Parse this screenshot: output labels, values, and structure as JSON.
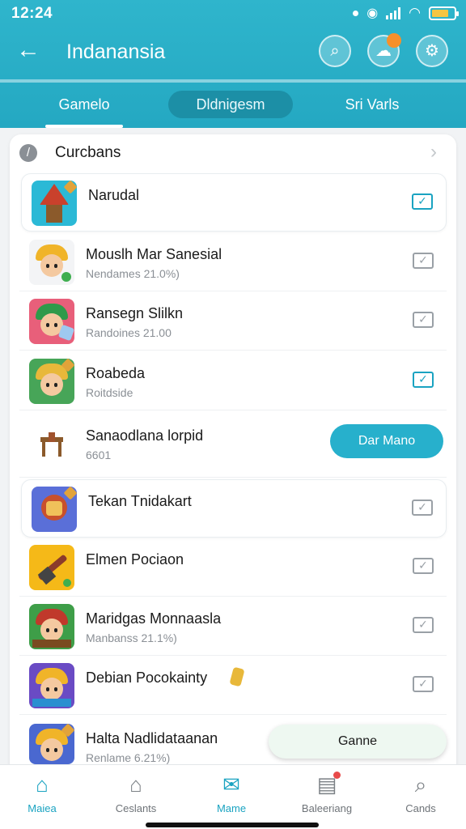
{
  "status_bar": {
    "time": "12:24"
  },
  "header": {
    "title": "Indanansia",
    "back_icon": "arrow-left-icon",
    "icons": [
      "search-icon",
      "avatar-chat-icon",
      "settings-icon"
    ],
    "accent": "#2fb5cc"
  },
  "tabs": [
    {
      "label": "Gamelo"
    },
    {
      "label": "Dldnigesm"
    },
    {
      "label": "Sri Varls"
    }
  ],
  "section": {
    "title": "Curcbans"
  },
  "rows": [
    {
      "title": "Narudal",
      "subtitle": "",
      "checked": true
    },
    {
      "title": "Mouslh Mar Sanesial",
      "subtitle": "Nendames 21.0%)",
      "checked": false
    },
    {
      "title": "Ransegn Slilkn",
      "subtitle": "Randoines 21.00",
      "checked": false
    },
    {
      "title": "Roabeda",
      "subtitle": "Roitdside",
      "checked": true
    },
    {
      "title": "Sanaodlana lorpid",
      "subtitle": "6601",
      "action": "Dar Mano"
    },
    {
      "title": "Tekan Tnidakart",
      "subtitle": "",
      "checked": false
    },
    {
      "title": "Elmen Pociaon",
      "subtitle": "",
      "checked": false
    },
    {
      "title": "Maridgas Monnaasla",
      "subtitle": "Manbanss 21.1%)",
      "checked": false
    },
    {
      "title": "Debian Pocokainty",
      "subtitle": "",
      "checked": false
    },
    {
      "title": "Halta Nadlidataanan",
      "subtitle": "Renlame 6.21%)"
    }
  ],
  "floating_button": {
    "label": "Ganne"
  },
  "bottom_nav": [
    {
      "label": "Maiea",
      "icon": "home-icon"
    },
    {
      "label": "Ceslants",
      "icon": "house-outline-icon"
    },
    {
      "label": "Mame",
      "icon": "chat-icon"
    },
    {
      "label": "Baleeriang",
      "icon": "news-icon"
    },
    {
      "label": "Cands",
      "icon": "search-icon"
    }
  ]
}
